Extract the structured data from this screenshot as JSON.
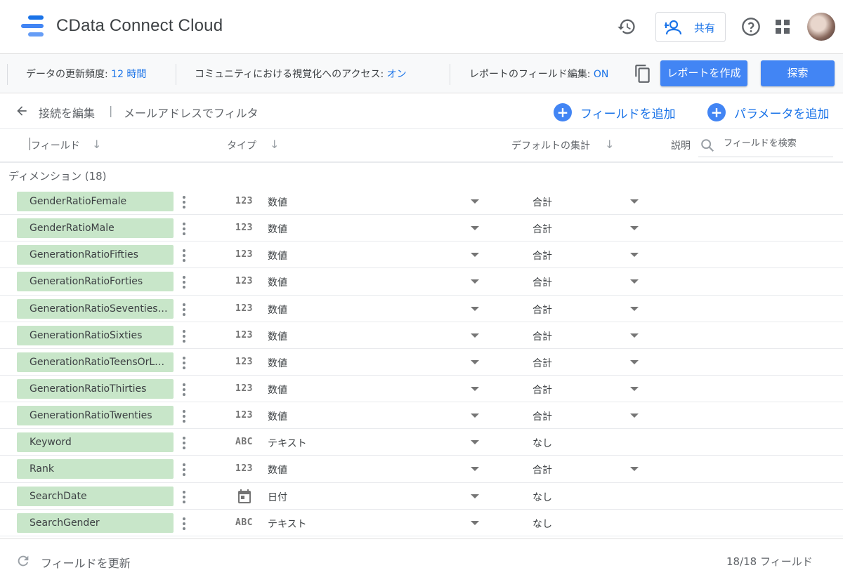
{
  "app": {
    "title": "CData Connect Cloud",
    "logo_colors": [
      "#1a73e8",
      "#4285f4",
      "#669df6"
    ]
  },
  "topbar": {
    "share_label": "共有",
    "icons": [
      "history-icon",
      "add-person-icon",
      "help-icon",
      "apps-grid-icon",
      "avatar"
    ]
  },
  "infobar": {
    "refresh_label": "データの更新頻度: ",
    "refresh_value": "12 時間",
    "community_label": "コミュニティにおける視覚化へのアクセス: ",
    "community_value": "オン",
    "field_edit_label": "レポートのフィールド編集: ",
    "field_edit_value": "ON",
    "create_report_label": "レポートを作成",
    "explore_label": "探索"
  },
  "subheader": {
    "edit_connection": "接続を編集",
    "divider": "|",
    "filter_by_email": "メールアドレスでフィルタ",
    "add_field": "フィールドを追加",
    "add_parameter": "パラメータを追加"
  },
  "columns": {
    "field": "フィールド",
    "type": "タイプ",
    "default_agg": "デフォルトの集計",
    "description": "説明",
    "search_placeholder": "フィールドを検索"
  },
  "section": {
    "label": "ディメンション (18)"
  },
  "rows": [
    {
      "name": "GenderRatioFemale",
      "type_icon": "123",
      "type": "数値",
      "agg": "合計",
      "agg_dropdown": true
    },
    {
      "name": "GenderRatioMale",
      "type_icon": "123",
      "type": "数値",
      "agg": "合計",
      "agg_dropdown": true
    },
    {
      "name": "GenerationRatioFifties",
      "type_icon": "123",
      "type": "数値",
      "agg": "合計",
      "agg_dropdown": true
    },
    {
      "name": "GenerationRatioForties",
      "type_icon": "123",
      "type": "数値",
      "agg": "合計",
      "agg_dropdown": true
    },
    {
      "name": "GenerationRatioSeventies…",
      "type_icon": "123",
      "type": "数値",
      "agg": "合計",
      "agg_dropdown": true
    },
    {
      "name": "GenerationRatioSixties",
      "type_icon": "123",
      "type": "数値",
      "agg": "合計",
      "agg_dropdown": true
    },
    {
      "name": "GenerationRatioTeensOrL…",
      "type_icon": "123",
      "type": "数値",
      "agg": "合計",
      "agg_dropdown": true
    },
    {
      "name": "GenerationRatioThirties",
      "type_icon": "123",
      "type": "数値",
      "agg": "合計",
      "agg_dropdown": true
    },
    {
      "name": "GenerationRatioTwenties",
      "type_icon": "123",
      "type": "数値",
      "agg": "合計",
      "agg_dropdown": true
    },
    {
      "name": "Keyword",
      "type_icon": "ABC",
      "type": "テキスト",
      "agg": "なし",
      "agg_dropdown": false
    },
    {
      "name": "Rank",
      "type_icon": "123",
      "type": "数値",
      "agg": "合計",
      "agg_dropdown": true
    },
    {
      "name": "SearchDate",
      "type_icon": "calendar-icon",
      "type": "日付",
      "agg": "なし",
      "agg_dropdown": false
    },
    {
      "name": "SearchGender",
      "type_icon": "ABC",
      "type": "テキスト",
      "agg": "なし",
      "agg_dropdown": false
    }
  ],
  "footer": {
    "refresh_fields": "フィールドを更新",
    "field_count": "18/18 フィールド"
  }
}
